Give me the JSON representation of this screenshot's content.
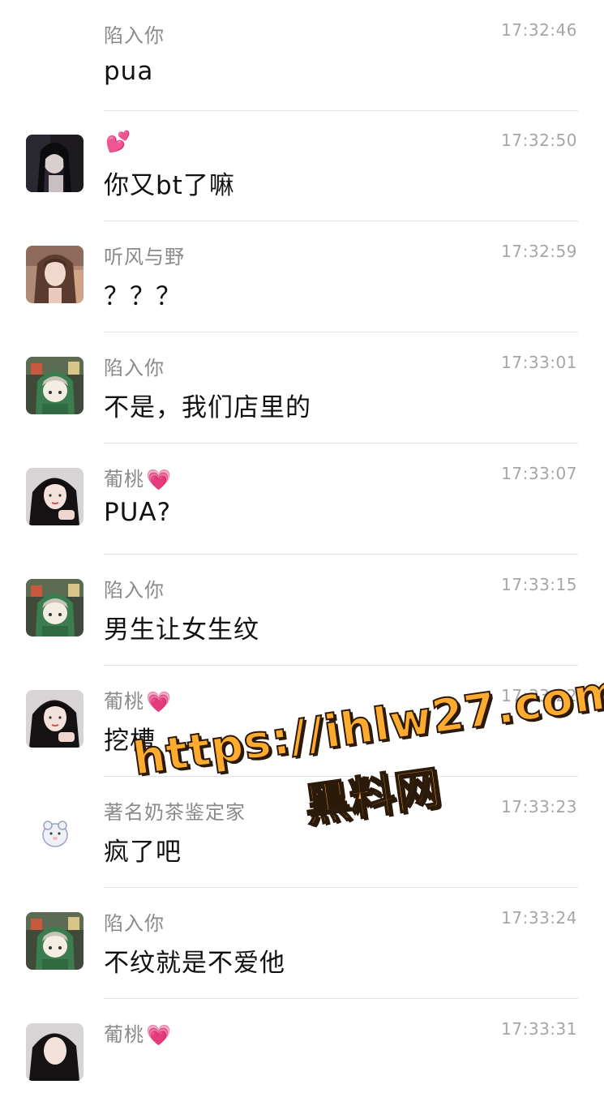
{
  "messages": [
    {
      "sender": "陷入你",
      "heart": "",
      "time": "17:32:46",
      "text": "pua",
      "avatar": "none"
    },
    {
      "sender": "",
      "heart": "💕",
      "time": "17:32:50",
      "text": "你又bt了嘛",
      "avatar": "dark-girl-photo"
    },
    {
      "sender": "听风与野",
      "heart": "",
      "time": "17:32:59",
      "text": "？？？",
      "avatar": "girl-photo-warm"
    },
    {
      "sender": "陷入你",
      "heart": "",
      "time": "17:33:01",
      "text": "不是，我们店里的",
      "avatar": "anime-green-hood"
    },
    {
      "sender": "葡桃",
      "heart": "💗",
      "time": "17:33:07",
      "text": "PUA?",
      "avatar": "girl-photo-dark-hair"
    },
    {
      "sender": "陷入你",
      "heart": "",
      "time": "17:33:15",
      "text": "男生让女生纹",
      "avatar": "anime-green-hood"
    },
    {
      "sender": "葡桃",
      "heart": "💗",
      "time": "17:33:22",
      "text": "挖槽",
      "avatar": "girl-photo-dark-hair"
    },
    {
      "sender": "著名奶茶鉴定家",
      "heart": "",
      "time": "17:33:23",
      "text": "疯了吧",
      "avatar": "hamster-cartoon"
    },
    {
      "sender": "陷入你",
      "heart": "",
      "time": "17:33:24",
      "text": "不纹就是不爱他",
      "avatar": "anime-green-hood"
    },
    {
      "sender": "葡桃",
      "heart": "💗",
      "time": "17:33:31",
      "text": "",
      "avatar": "girl-photo-dark-hair"
    }
  ],
  "watermark": {
    "url": "https://ihlw27.com",
    "name": "黑料网"
  },
  "colors": {
    "heart": "#ff4fa3",
    "watermark_fill": "#ffab2e"
  }
}
